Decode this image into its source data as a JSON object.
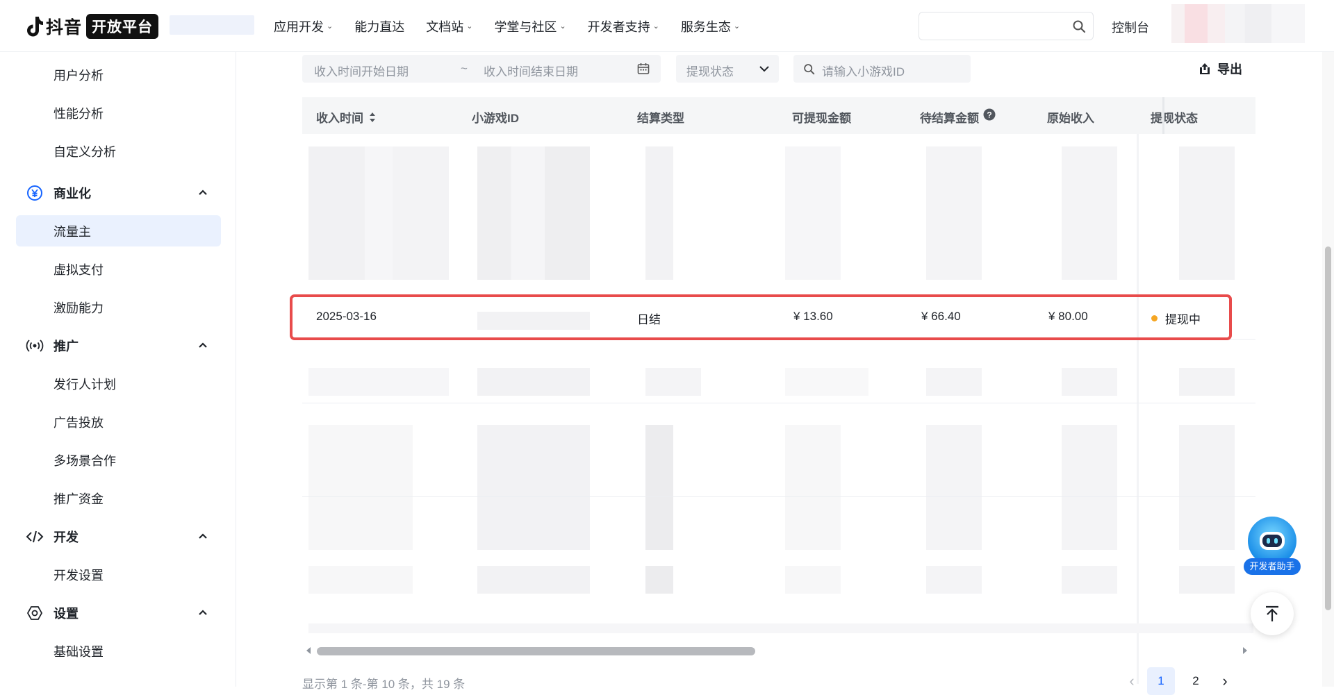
{
  "brand": {
    "name": "抖音",
    "badge": "开放平台"
  },
  "nav": {
    "items": [
      {
        "label": "应用开发",
        "has_menu": true
      },
      {
        "label": "能力直达",
        "has_menu": false
      },
      {
        "label": "文档站",
        "has_menu": true
      },
      {
        "label": "学堂与社区",
        "has_menu": true
      },
      {
        "label": "开发者支持",
        "has_menu": true
      },
      {
        "label": "服务生态",
        "has_menu": true
      }
    ],
    "console": "控制台",
    "search_placeholder": ""
  },
  "sidebar": {
    "items": [
      {
        "label": "用户分析"
      },
      {
        "label": "性能分析"
      },
      {
        "label": "自定义分析"
      }
    ],
    "groups": [
      {
        "label": "商业化",
        "icon": "yen-circle-icon",
        "children": [
          "流量主",
          "虚拟支付",
          "激励能力"
        ],
        "active": "流量主"
      },
      {
        "label": "推广",
        "icon": "broadcast-icon",
        "children": [
          "发行人计划",
          "广告投放",
          "多场景合作",
          "推广资金"
        ]
      },
      {
        "label": "开发",
        "icon": "code-icon",
        "children": [
          "开发设置"
        ]
      },
      {
        "label": "设置",
        "icon": "hexagon-settings-icon",
        "children": [
          "基础设置"
        ]
      }
    ]
  },
  "filters": {
    "date_start_placeholder": "收入时间开始日期",
    "date_separator": "~",
    "date_end_placeholder": "收入时间结束日期",
    "status_placeholder": "提现状态",
    "game_id_placeholder": "请输入小游戏ID",
    "export_label": "导出"
  },
  "table": {
    "columns": [
      "收入时间",
      "小游戏ID",
      "结算类型",
      "可提现金额",
      "待结算金额",
      "原始收入",
      "提现状态"
    ],
    "highlighted_row": {
      "income_time": "2025-03-16",
      "game_id": "",
      "settlement_type": "日结",
      "withdrawable": "¥ 13.60",
      "pending": "¥ 66.40",
      "original_income": "¥ 80.00",
      "status": "提现中",
      "status_color": "#f5a623"
    },
    "highlight_color": "#e84b4b"
  },
  "pagination": {
    "summary": "显示第 1 条-第 10 条，共 19 条",
    "pages": [
      "1",
      "2"
    ],
    "current": "1"
  },
  "helper": {
    "label": "开发者助手"
  },
  "colors": {
    "accent": "#1664ff",
    "active_bg": "#eaf1fe"
  }
}
